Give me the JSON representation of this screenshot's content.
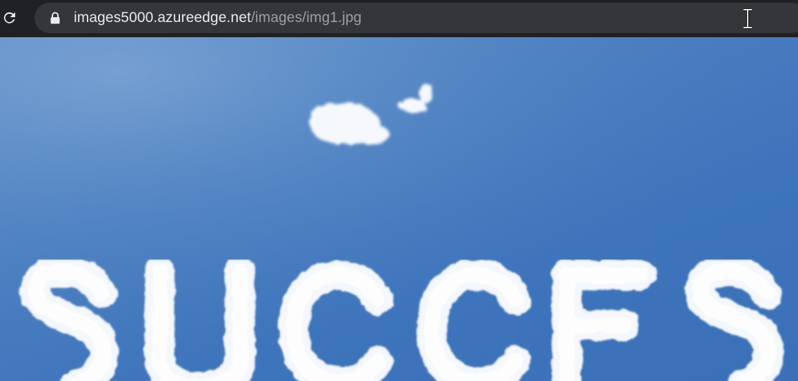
{
  "browser": {
    "url_host": "images5000.azureedge.net",
    "url_path": "/images/img1.jpg"
  },
  "icons": {
    "reload": "reload-icon",
    "secure": "lock-icon",
    "cursor": "text-cursor-icon"
  },
  "image": {
    "description_word": "SUCCESS",
    "sky_color": "#4277bd",
    "cloud_color": "#ffffff"
  }
}
